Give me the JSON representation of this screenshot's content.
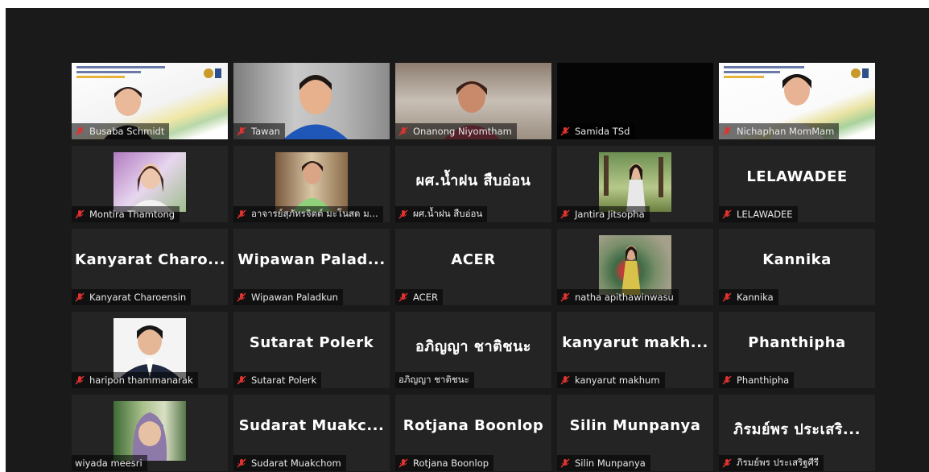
{
  "participants": [
    {
      "name": "Busaba Schmidt",
      "display": ""
    },
    {
      "name": "Tawan",
      "display": ""
    },
    {
      "name": "Onanong Niyomtham",
      "display": ""
    },
    {
      "name": "Samida TSd",
      "display": ""
    },
    {
      "name": "Nichaphan MomMam",
      "display": ""
    },
    {
      "name": "Montira Thamtong",
      "display": ""
    },
    {
      "name": "อาจารย์สุภัทรจิตต์ มะโนสด ม...",
      "display": ""
    },
    {
      "name": "ผศ.น้ำฝน สืบอ่อน",
      "display": "ผศ.น้ำฝน สืบอ่อน"
    },
    {
      "name": "Jantira Jitsopha",
      "display": ""
    },
    {
      "name": "LELAWADEE",
      "display": "LELAWADEE"
    },
    {
      "name": "Kanyarat Charoensin",
      "display": "Kanyarat  Charo..."
    },
    {
      "name": "Wipawan Paladkun",
      "display": "Wipawan  Palad..."
    },
    {
      "name": "ACER",
      "display": "ACER"
    },
    {
      "name": "natha apithawinwasu",
      "display": ""
    },
    {
      "name": "Kannika",
      "display": "Kannika"
    },
    {
      "name": "haripon thammanarak",
      "display": ""
    },
    {
      "name": "Sutarat Polerk",
      "display": "Sutarat Polerk"
    },
    {
      "name": "อภิญญา ชาติชนะ",
      "display": "อภิญญา  ชาติชนะ"
    },
    {
      "name": "kanyarut makhum",
      "display": "kanyarut  makh..."
    },
    {
      "name": "Phanthipha",
      "display": "Phanthipha"
    },
    {
      "name": "wiyada meesri",
      "display": ""
    },
    {
      "name": "Sudarat Muakchom",
      "display": "Sudarat  Muakc..."
    },
    {
      "name": "Rotjana Boonlop",
      "display": "Rotjana Boonlop"
    },
    {
      "name": "Silin Munpanya",
      "display": "Silin Munpanya"
    },
    {
      "name": "ภิรมย์พร ประเสริฐศีรี",
      "display": "ภิรมย์พร  ประเสริ..."
    }
  ],
  "colors": {
    "muted_mic": "#e0332f",
    "tile_bg": "#242424",
    "screen_bg": "#1a1a1a"
  }
}
